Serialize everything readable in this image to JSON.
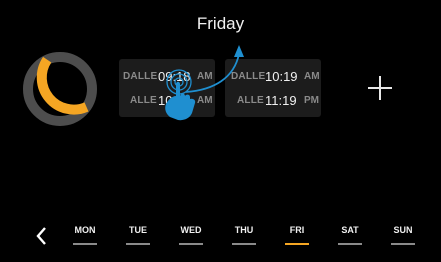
{
  "header": {
    "day_title": "Friday"
  },
  "schedule": {
    "ring": {
      "active_color": "#f5a623",
      "inactive_color": "#4d4d4d"
    },
    "slots": [
      {
        "from_label": "DALLE",
        "from_time": "09:18",
        "from_ampm": "AM",
        "to_label": "ALLE",
        "to_time": "10:18",
        "to_ampm": "AM"
      },
      {
        "from_label": "DALLE",
        "from_time": "10:19",
        "from_ampm": "AM",
        "to_label": "ALLE",
        "to_time": "11:19",
        "to_ampm": "PM"
      }
    ],
    "add_icon": "plus-icon"
  },
  "nav": {
    "back_icon": "chevron-left-icon",
    "days": [
      "MON",
      "TUE",
      "WED",
      "THU",
      "FRI",
      "SAT",
      "SUN"
    ],
    "active_day": "FRI",
    "active_color": "#f5a623"
  },
  "gesture": {
    "icon": "tap-hand-icon",
    "color": "#1f8fd0"
  }
}
